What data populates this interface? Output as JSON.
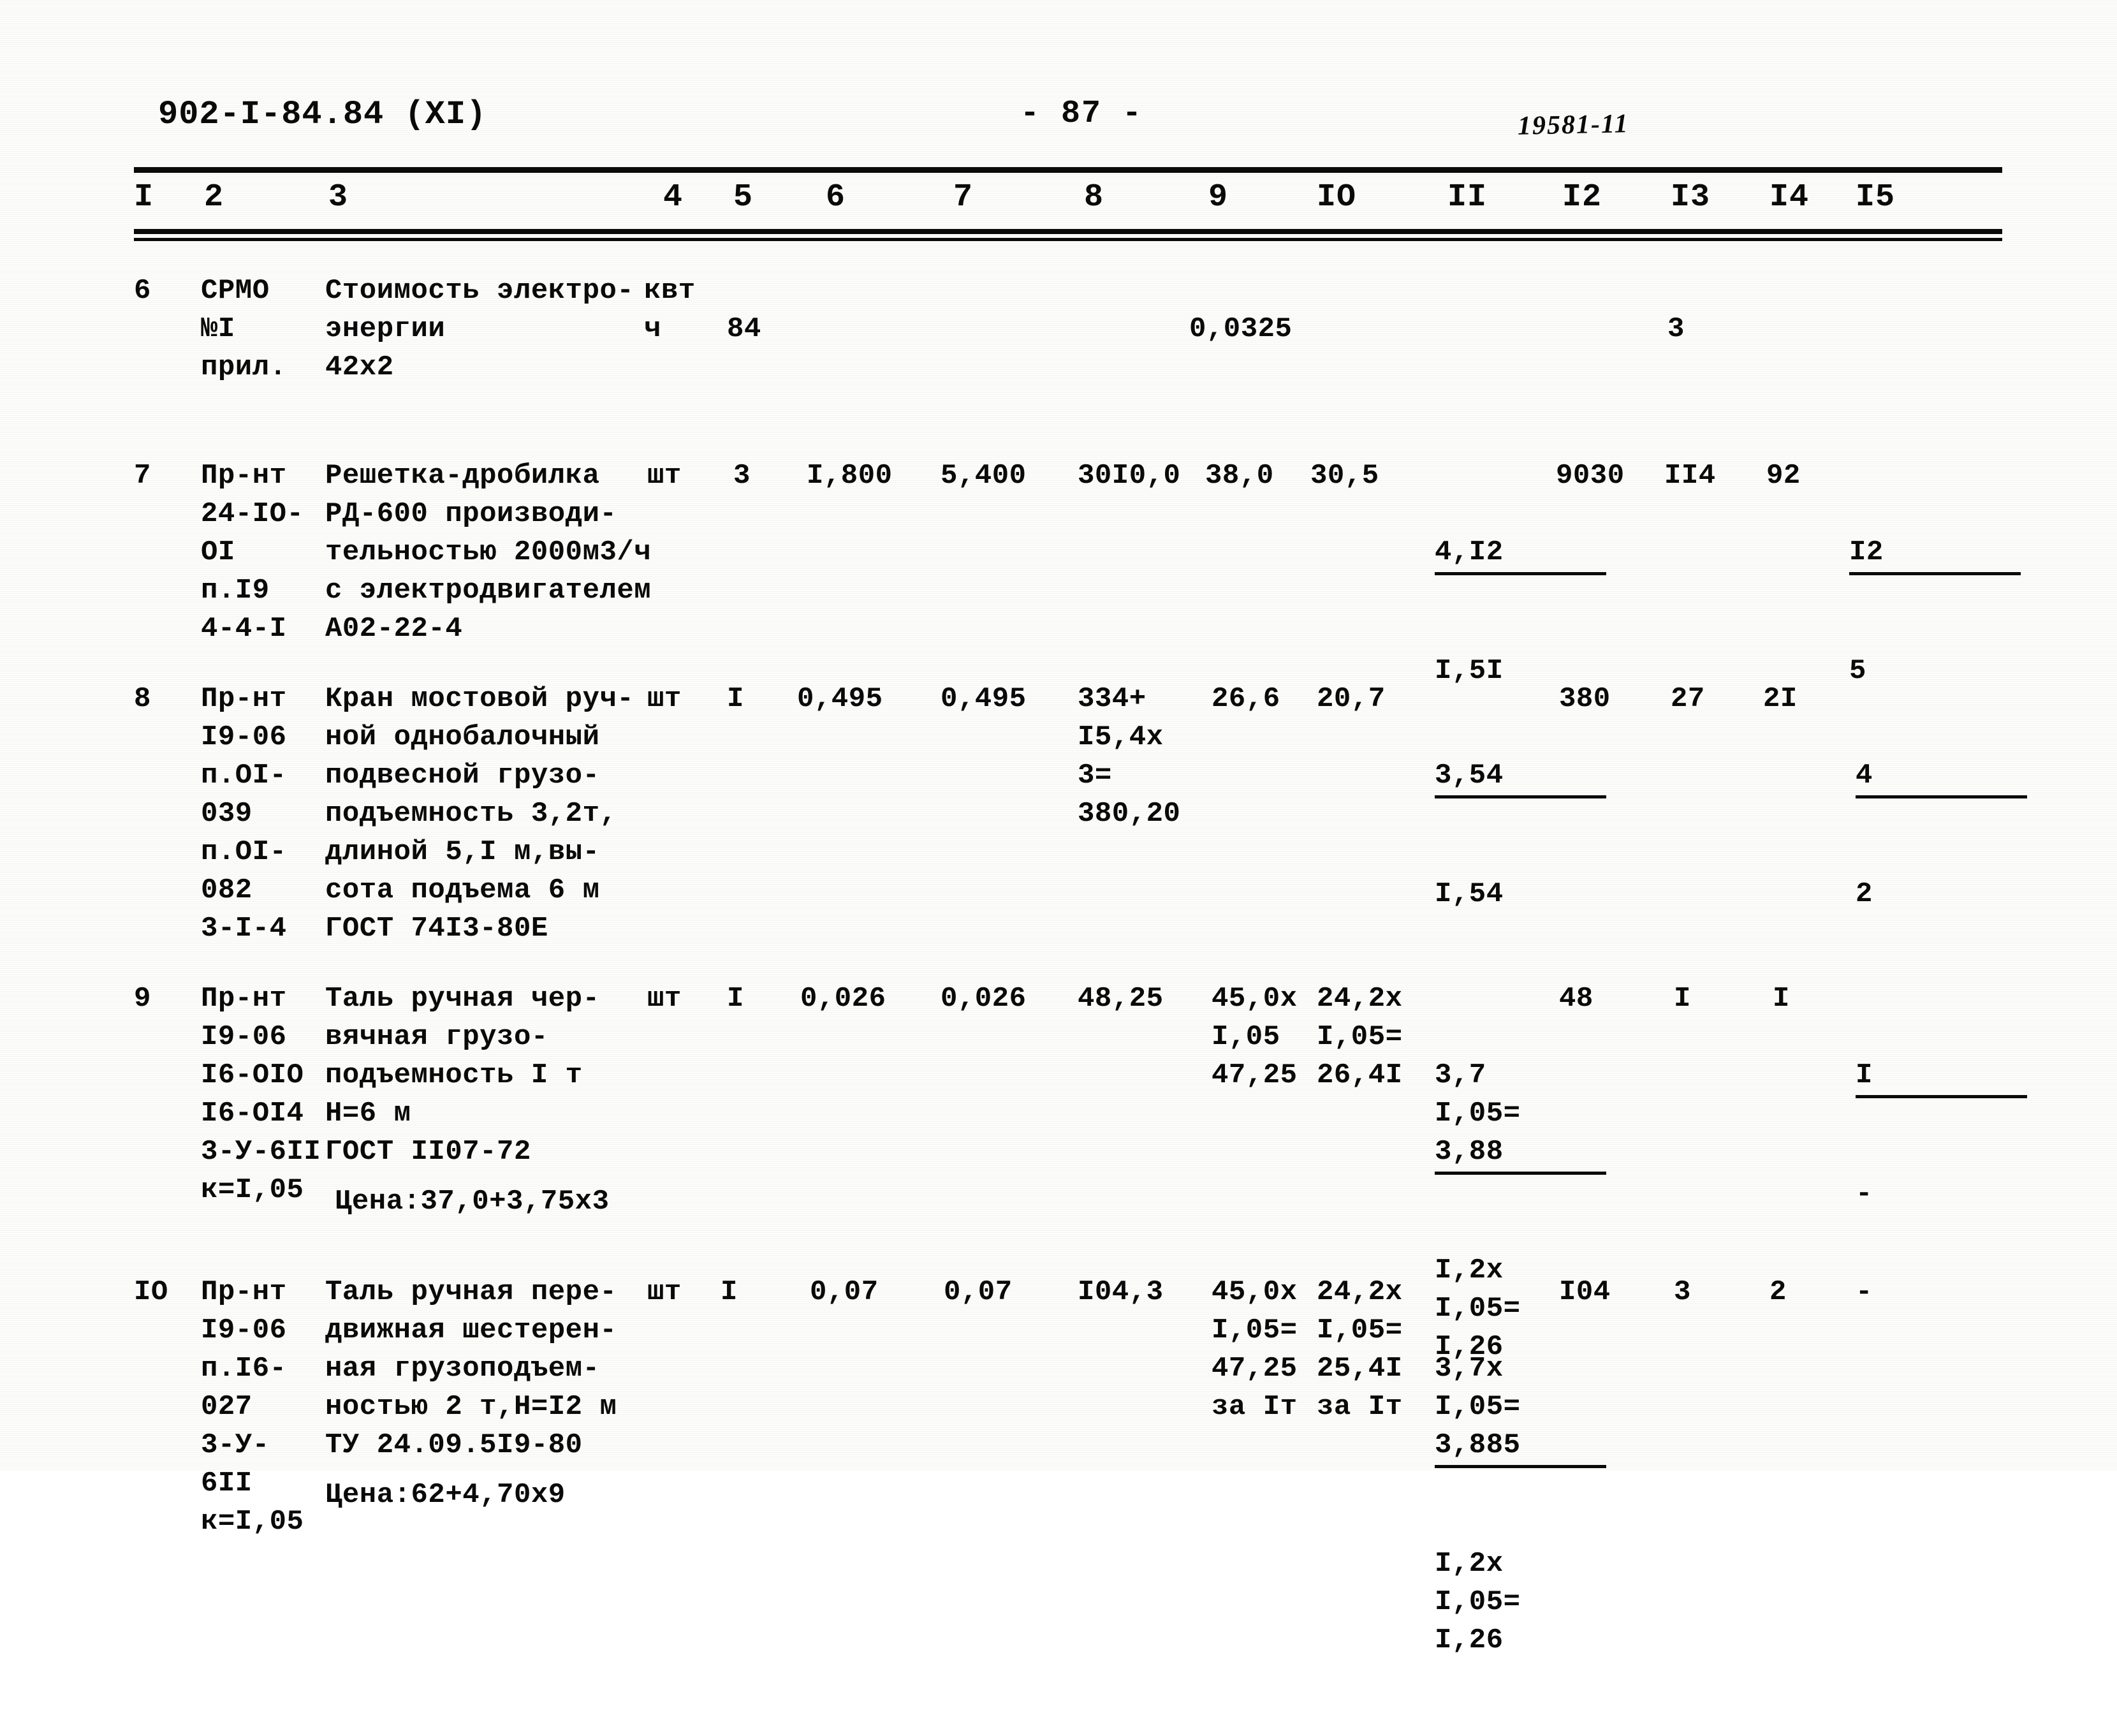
{
  "header": {
    "doc_code": "902-I-84.84 (XI)",
    "page_number": "- 87 -",
    "hand_note": "19581-11"
  },
  "table": {
    "column_headers": [
      "I",
      "2",
      "3",
      "4",
      "5",
      "6",
      "7",
      "8",
      "9",
      "IO",
      "II",
      "I2",
      "I3",
      "I4",
      "I5"
    ],
    "rows": [
      {
        "c1": "6",
        "c2": "СРМО\n№I\nприл.",
        "c3": "Стоимость электро-\nэнергии\n42х2",
        "c4": "квт\nч",
        "c5": "84",
        "c6": "",
        "c7": "",
        "c8": "",
        "c9": "0,0325",
        "c10": "",
        "c11": "",
        "c12": "",
        "c13": "3",
        "c14": "",
        "c15": ""
      },
      {
        "c1": "7",
        "c2": "Пр-нт\n24-IO-\nOI\nп.I9\n4-4-I",
        "c3": "Решетка-дробилка\nРД-600 производи-\nтельностью 2000м3/ч\nс электродвигателем\nА02-22-4",
        "c4": "шт",
        "c5": "3",
        "c6": "I,800",
        "c7": "5,400",
        "c8": "30I0,0",
        "c9": "38,0",
        "c10": "30,5",
        "c11_num": "4,I2",
        "c11_den": "I,5I",
        "c12": "9030",
        "c13": "II4",
        "c14": "92",
        "c15_num": "I2",
        "c15_den": "5"
      },
      {
        "c1": "8",
        "c2": "Пр-нт\nI9-06\nп.OI-\n039\nп.OI-\n082\n3-I-4",
        "c3": "Кран мостовой руч-\nной однобалочный\nподвесной грузо-\nподъемность 3,2т,\nдлиной 5,I м,вы-\nсота подъема 6 м\nГОСТ 74I3-80Е",
        "c4": "шт",
        "c5": "I",
        "c6": "0,495",
        "c7": "0,495",
        "c8": "334+\nI5,4х\n3=\n380,20",
        "c9": "26,6",
        "c10": "20,7",
        "c11_num": "3,54",
        "c11_den": "I,54",
        "c12": "380",
        "c13": "27",
        "c14": "2I",
        "c15_num": "4",
        "c15_den": "2"
      },
      {
        "c1": "9",
        "c2": "Пр-нт\nI9-06\nI6-OIO\nI6-OI4\n3-У-6II\nк=I,05",
        "c3": "Таль ручная чер-\nвячная грузо-\nподъемность I т\nН=6 м\nГОСТ II07-72",
        "c3b": "Цена:37,0+3,75х3",
        "c4": "шт",
        "c5": "I",
        "c6": "0,026",
        "c7": "0,026",
        "c8": "48,25",
        "c9": "45,0х\nI,05\n47,25",
        "c10": "24,2х\nI,05=\n26,4I",
        "c11_num": "3,7\nI,05=\n3,88",
        "c11_den": "I,2х\nI,05=\nI,26",
        "c12": "48",
        "c13": "I",
        "c14": "I",
        "c15_num": "I",
        "c15_den": "-"
      },
      {
        "c1": "IO",
        "c2": "Пр-нт\nI9-06\nп.I6-\n027\n3-У-\n6II\nк=I,05",
        "c3": "Таль ручная пере-\nдвижная шестерен-\nная грузоподъем-\nностью 2 т,Н=I2 м\nТУ 24.09.5I9-80",
        "c3b": "Цена:62+4,70х9",
        "c4": "шт",
        "c5": "I",
        "c6": "0,07",
        "c7": "0,07",
        "c8": "I04,3",
        "c9": "45,0х\nI,05=\n47,25\nза Iт",
        "c10": "24,2х\nI,05=\n25,4I\nза Iт",
        "c11_num": "3,7х\nI,05=\n3,885",
        "c11_den": "I,2х\nI,05=\nI,26",
        "c12": "I04",
        "c13": "3",
        "c14": "2",
        "c15": "-"
      }
    ]
  }
}
